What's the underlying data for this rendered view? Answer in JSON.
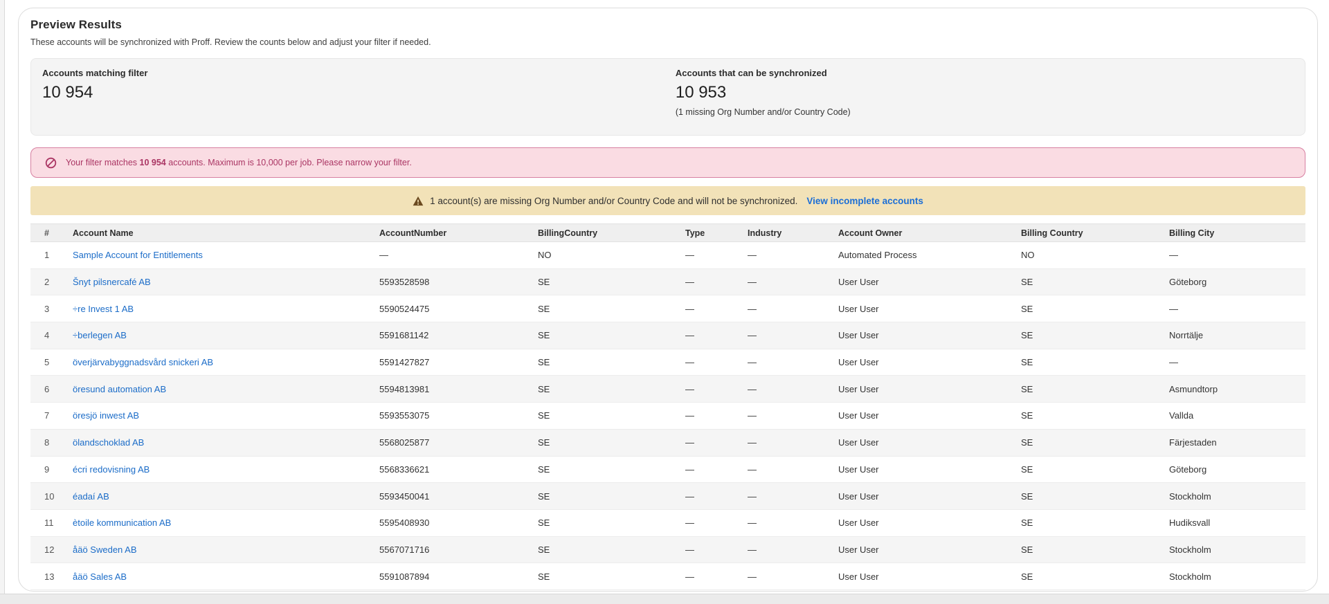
{
  "page": {
    "title": "Preview Results",
    "subtitle": "These accounts will be synchronized with Proff. Review the counts below and adjust your filter if needed."
  },
  "stats": {
    "matching_label": "Accounts matching filter",
    "matching_value": "10 954",
    "sync_label": "Accounts that can be synchronized",
    "sync_value": "10 953",
    "sync_note": "(1 missing Org Number and/or Country Code)"
  },
  "error_banner": {
    "icon": "no-entry-icon",
    "prefix": "Your filter matches ",
    "count": "10 954",
    "suffix": " accounts. Maximum is 10,000 per job. Please narrow your filter."
  },
  "warning_banner": {
    "icon": "warning-triangle-icon",
    "text": "1 account(s) are missing Org Number and/or Country Code and will not be synchronized.",
    "link_label": "View incomplete accounts"
  },
  "table": {
    "columns": [
      "#",
      "Account Name",
      "AccountNumber",
      "BillingCountry",
      "Type",
      "Industry",
      "Account Owner",
      "Billing Country",
      "Billing City"
    ],
    "rows": [
      [
        "1",
        "Sample Account for Entitlements",
        "—",
        "NO",
        "—",
        "—",
        "Automated Process",
        "NO",
        "—"
      ],
      [
        "2",
        "Šnyt pilsnercafé AB",
        "5593528598",
        "SE",
        "—",
        "—",
        "User User",
        "SE",
        "Göteborg"
      ],
      [
        "3",
        "÷re Invest 1 AB",
        "5590524475",
        "SE",
        "—",
        "—",
        "User User",
        "SE",
        "—"
      ],
      [
        "4",
        "÷berlegen AB",
        "5591681142",
        "SE",
        "—",
        "—",
        "User User",
        "SE",
        "Norrtälje"
      ],
      [
        "5",
        "överjärvabyggnadsvård snickeri AB",
        "5591427827",
        "SE",
        "—",
        "—",
        "User User",
        "SE",
        "—"
      ],
      [
        "6",
        "öresund automation AB",
        "5594813981",
        "SE",
        "—",
        "—",
        "User User",
        "SE",
        "Asmundtorp"
      ],
      [
        "7",
        "öresjö inwest AB",
        "5593553075",
        "SE",
        "—",
        "—",
        "User User",
        "SE",
        "Vallda"
      ],
      [
        "8",
        "ölandschoklad AB",
        "5568025877",
        "SE",
        "—",
        "—",
        "User User",
        "SE",
        "Färjestaden"
      ],
      [
        "9",
        "écri redovisning AB",
        "5568336621",
        "SE",
        "—",
        "—",
        "User User",
        "SE",
        "Göteborg"
      ],
      [
        "10",
        "éadaí AB",
        "5593450041",
        "SE",
        "—",
        "—",
        "User User",
        "SE",
        "Stockholm"
      ],
      [
        "11",
        "ètoile kommunication AB",
        "5595408930",
        "SE",
        "—",
        "—",
        "User User",
        "SE",
        "Hudiksvall"
      ],
      [
        "12",
        "åäö Sweden AB",
        "5567071716",
        "SE",
        "—",
        "—",
        "User User",
        "SE",
        "Stockholm"
      ],
      [
        "13",
        "åäö Sales AB",
        "5591087894",
        "SE",
        "—",
        "—",
        "User User",
        "SE",
        "Stockholm"
      ]
    ]
  },
  "colors": {
    "link_blue": "#1b6cc8",
    "warning_link_blue": "#1b6ed6",
    "error_text": "#aa3563",
    "error_bg": "#fadce3",
    "error_border": "#d77fa1",
    "warning_bg": "#f2e2b8",
    "warning_icon_brown": "#6b4a20",
    "stats_bg": "#f4f4f4",
    "header_row_bg": "#efefef",
    "stripe_row_bg": "#f5f5f5"
  }
}
